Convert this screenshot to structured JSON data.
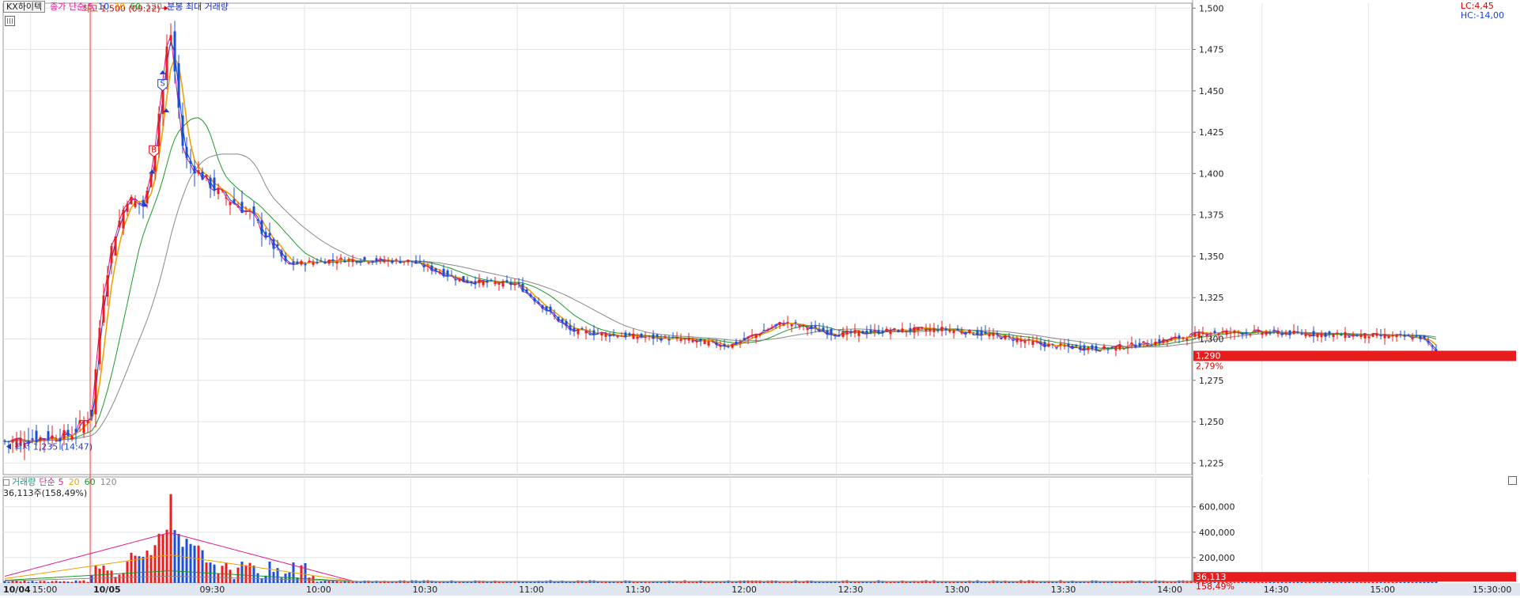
{
  "symbol": "KX하이텍",
  "price_legend": {
    "label": "종가 단순",
    "periods": [
      {
        "text": "5",
        "color": "#e0188c"
      },
      {
        "text": "10",
        "color": "#1a3fd8"
      },
      {
        "text": "20",
        "color": "#f0a000"
      },
      {
        "text": "60",
        "color": "#1a9a2a"
      },
      {
        "text": "120",
        "color": "#888888"
      }
    ],
    "extra": "분봉 최대 거래량"
  },
  "volume_legend": {
    "label": "거래량",
    "ma_label": "단순",
    "periods": [
      {
        "text": "5",
        "color": "#e0188c"
      },
      {
        "text": "20",
        "color": "#f0a000"
      },
      {
        "text": "60",
        "color": "#1a9a2a"
      },
      {
        "text": "120",
        "color": "#888888"
      }
    ],
    "current": "36,113주(158,49%)"
  },
  "top_right": {
    "lc": "LC:4,45",
    "hc": "HC:-14,00"
  },
  "annotations": {
    "high": "최고 1,500 (09:22)",
    "low": "최저 1,235 (14:47)",
    "signal_s": "S",
    "signal_b": "B"
  },
  "price_badge": {
    "value": "1,290",
    "change": "2,79%"
  },
  "volume_badge": {
    "value": "36,113",
    "ratio": "158,49%"
  },
  "colors": {
    "up": "#ee1c1c",
    "down": "#1a4fd8",
    "grid": "#e3e3e3",
    "session": "#ff3333"
  },
  "chart_data": [
    {
      "type": "candlestick",
      "title": "",
      "timeframe": "1-minute",
      "y_ticks": [
        "1,225",
        "1,250",
        "1,275",
        "1,300",
        "1,325",
        "1,350",
        "1,375",
        "1,400",
        "1,425",
        "1,450",
        "1,475",
        "1,500"
      ],
      "ylim": [
        1218,
        1503
      ],
      "x_ticks": [
        "10/04",
        "15:00",
        "10/05",
        "09:30",
        "10:00",
        "10:30",
        "11:00",
        "11:30",
        "12:00",
        "12:30",
        "13:00",
        "13:30",
        "14:00",
        "14:30",
        "15:00",
        "15:30:00"
      ],
      "high": {
        "value": 1500,
        "time": "09:22"
      },
      "low": {
        "value": 1235,
        "time": "14:47"
      },
      "last": 1290,
      "change_pct": 2.79,
      "close_path": [
        {
          "t": "10/04 14:47",
          "v": 1238
        },
        {
          "t": "10/04 15:20",
          "v": 1242
        },
        {
          "t": "09:00",
          "v": 1255
        },
        {
          "t": "09:03",
          "v": 1325
        },
        {
          "t": "09:06",
          "v": 1360
        },
        {
          "t": "09:10",
          "v": 1385
        },
        {
          "t": "09:15",
          "v": 1380
        },
        {
          "t": "09:18",
          "v": 1420
        },
        {
          "t": "09:22",
          "v": 1490
        },
        {
          "t": "09:26",
          "v": 1410
        },
        {
          "t": "09:35",
          "v": 1390
        },
        {
          "t": "09:45",
          "v": 1375
        },
        {
          "t": "09:55",
          "v": 1345
        },
        {
          "t": "10:10",
          "v": 1348
        },
        {
          "t": "10:30",
          "v": 1347
        },
        {
          "t": "10:45",
          "v": 1335
        },
        {
          "t": "11:00",
          "v": 1333
        },
        {
          "t": "11:15",
          "v": 1305
        },
        {
          "t": "11:30",
          "v": 1302
        },
        {
          "t": "11:45",
          "v": 1300
        },
        {
          "t": "12:00",
          "v": 1296
        },
        {
          "t": "12:15",
          "v": 1310
        },
        {
          "t": "12:30",
          "v": 1303
        },
        {
          "t": "12:45",
          "v": 1305
        },
        {
          "t": "13:00",
          "v": 1306
        },
        {
          "t": "13:15",
          "v": 1302
        },
        {
          "t": "13:30",
          "v": 1296
        },
        {
          "t": "13:45",
          "v": 1294
        },
        {
          "t": "14:00",
          "v": 1298
        },
        {
          "t": "14:15",
          "v": 1304
        },
        {
          "t": "14:30",
          "v": 1304
        },
        {
          "t": "14:45",
          "v": 1303
        },
        {
          "t": "15:00",
          "v": 1302
        },
        {
          "t": "15:15",
          "v": 1301
        },
        {
          "t": "15:20",
          "v": 1290
        }
      ],
      "moving_averages": [
        {
          "name": "5",
          "color": "#e0188c"
        },
        {
          "name": "10",
          "color": "#1a3fd8"
        },
        {
          "name": "20",
          "color": "#f0a000"
        },
        {
          "name": "60",
          "color": "#1a9a2a"
        },
        {
          "name": "120",
          "color": "#888888"
        }
      ]
    },
    {
      "type": "bar",
      "title": "거래량",
      "y_ticks": [
        "200,000",
        "400,000",
        "600,000"
      ],
      "ylim": [
        0,
        760000
      ],
      "last": 36113,
      "ratio_pct": 158.49,
      "peak": {
        "time": "09:22",
        "value": 700000
      }
    }
  ]
}
